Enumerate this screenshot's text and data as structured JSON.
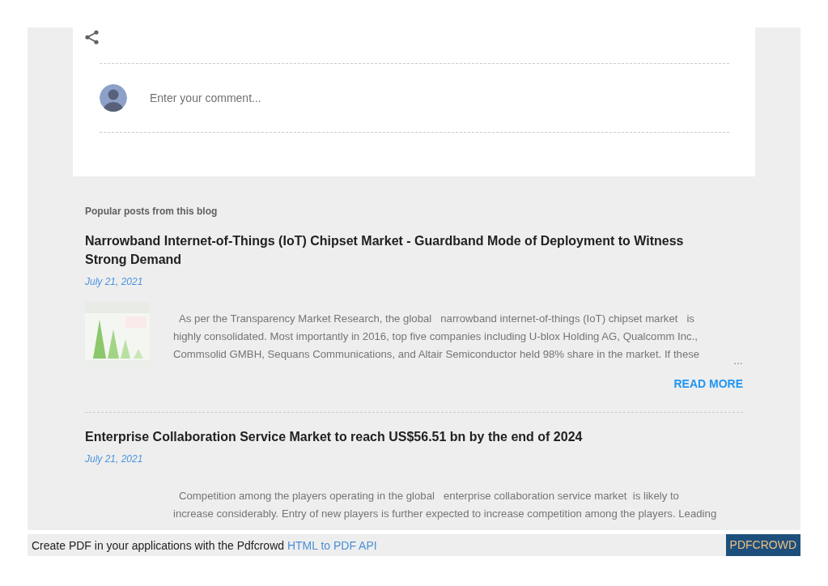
{
  "comment_box": {
    "placeholder": "Enter your comment..."
  },
  "popular_posts": {
    "heading": "Popular posts from this blog",
    "posts": [
      {
        "title": "Narrowband Internet-of-Things (IoT) Chipset Market - Guardband Mode of Deployment to Witness Strong Demand",
        "date": "July 21, 2021",
        "snippet": "As per the Transparency Market Research, the global   narrowband internet-of-things (IoT) chipset market   is highly consolidated. Most importantly in 2016, top five companies including U-blox Holding AG, Qualcomm Inc., Commsolid GMBH, Sequans Communications, and Altair Semiconductor held 98% share in the market. If these",
        "ellipsis": "…",
        "read_more": "READ MORE"
      },
      {
        "title": "Enterprise Collaboration Service Market to reach US$56.51 bn by the end of 2024",
        "date": "July 21, 2021",
        "snippet": "Competition among the players operating in the global   enterprise collaboration service market  is likely to increase considerably. Entry of new players is further expected to increase competition among the players. Leading"
      }
    ]
  },
  "footer": {
    "text": "Create PDF in your applications with the Pdfcrowd",
    "link": "HTML to PDF API",
    "badge": "PDFCROWD"
  }
}
